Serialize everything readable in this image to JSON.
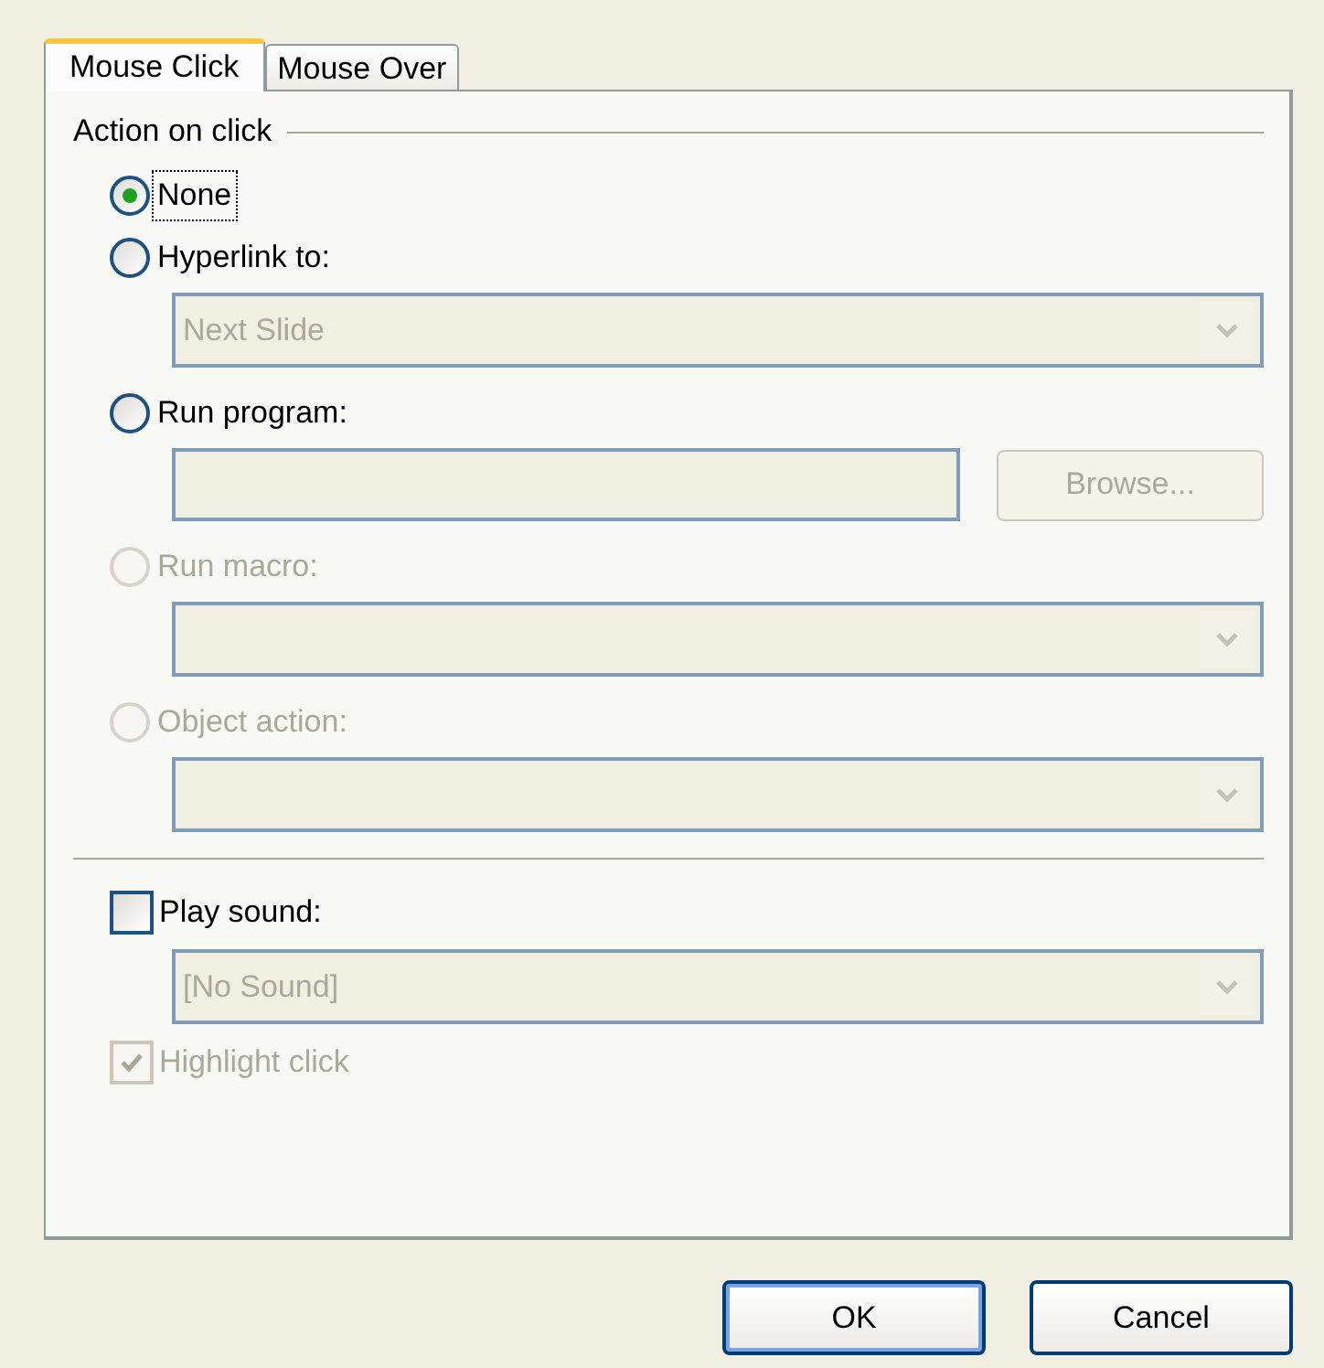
{
  "tabs": [
    {
      "label": "Mouse Click",
      "selected": true
    },
    {
      "label": "Mouse Over",
      "selected": false
    }
  ],
  "action_group": {
    "title": "Action on click",
    "options": [
      {
        "label": "None",
        "selected": true,
        "disabled": false,
        "focused": true
      },
      {
        "label": "Hyperlink to:",
        "selected": false,
        "disabled": false,
        "focused": false,
        "control": {
          "kind": "combo",
          "value": "Next Slide"
        }
      },
      {
        "label": "Run program:",
        "selected": false,
        "disabled": false,
        "focused": false,
        "control": {
          "kind": "field",
          "button": "Browse..."
        }
      },
      {
        "label": "Run macro:",
        "selected": false,
        "disabled": true,
        "focused": false,
        "control": {
          "kind": "combo"
        }
      },
      {
        "label": "Object action:",
        "selected": false,
        "disabled": true,
        "focused": false,
        "control": {
          "kind": "combo"
        }
      }
    ]
  },
  "play_sound": {
    "label": "Play sound:",
    "checked": false,
    "disabled": false,
    "combo": {
      "value": "[No Sound]"
    }
  },
  "highlight_click": {
    "label": "Highlight click",
    "checked": true,
    "disabled": true
  },
  "buttons": [
    {
      "label": "OK",
      "default": true
    },
    {
      "label": "Cancel",
      "default": false
    }
  ]
}
